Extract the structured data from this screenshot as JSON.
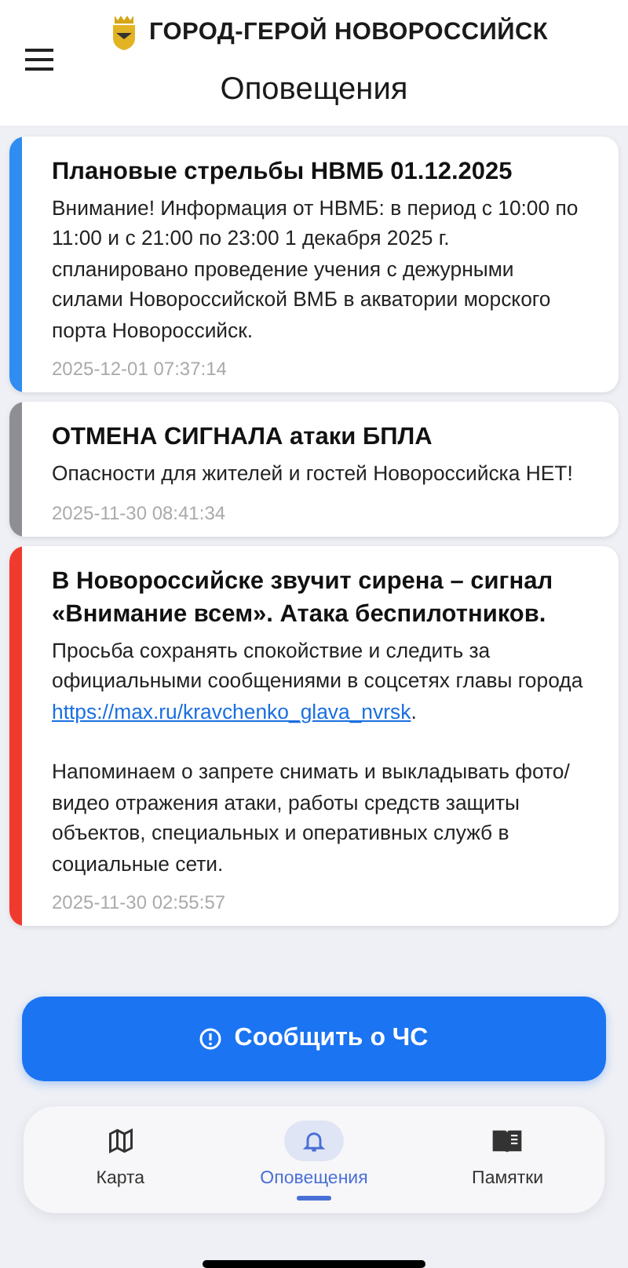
{
  "header": {
    "city": "ГОРОД-ГЕРОЙ НОВОРОССИЙСК",
    "title": "Оповещения"
  },
  "alerts": [
    {
      "color": "#2f8cf0",
      "title": "Плановые стрельбы НВМБ 01.12.2025",
      "paragraphs": [
        {
          "text": "Внимание! Информация от НВМБ: в период с 10:00 по 11:00 и с 21:00 по 23:00 1 декабря 2025 г. спланировано проведение учения с дежурными силами Новороссийской ВМБ в акватории морского порта Новороссийск."
        }
      ],
      "time": "2025-12-01 07:37:14"
    },
    {
      "color": "#8e8e93",
      "title": "ОТМЕНА СИГНАЛА атаки БПЛА",
      "paragraphs": [
        {
          "text": "Опасности для жителей и гостей Новороссийска НЕТ!"
        }
      ],
      "time": "2025-11-30 08:41:34"
    },
    {
      "color": "#f03a2e",
      "title": "В Новороссийске звучит сирена – сигнал «Внимание всем». Атака беспилотников.",
      "paragraphs": [
        {
          "text": "Просьба сохранять спокойствие и следить за официальными сообщениями в соцсетях главы города ",
          "link": "https://max.ru/kravchenko_glava_nvrsk",
          "after": "."
        },
        {
          "text": "Напоминаем о запрете снимать и выкладывать фото/видео отражения атаки, работы средств защиты объектов, специальных и оперативных служб в социальные сети."
        }
      ],
      "time": "2025-11-30 02:55:57"
    }
  ],
  "report_button": "Сообщить о ЧС",
  "nav": [
    {
      "kind": "map",
      "label": "Карта",
      "selected": false
    },
    {
      "kind": "bell",
      "label": "Оповещения",
      "selected": true
    },
    {
      "kind": "book",
      "label": "Памятки",
      "selected": false
    }
  ]
}
